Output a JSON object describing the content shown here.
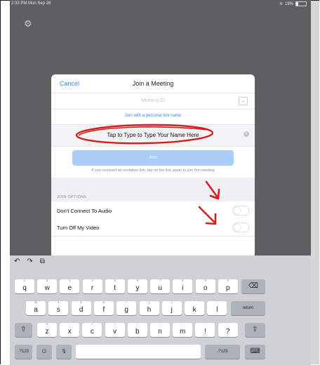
{
  "status_bar": {
    "time": "2:33 PM  Mon Sep 28",
    "battery": "19%"
  },
  "dialog": {
    "cancel": "Cancel",
    "title": "Join a Meeting",
    "meeting_id_placeholder": "Meeting ID",
    "personal_link": "Join with a personal link name",
    "name_field": "Tap to Type to Type Your Name Here",
    "join_button": "Join",
    "invite_text": "If you received an invitation link, tap on the link again to join the meeting",
    "join_options_label": "JOIN OPTIONS",
    "option_audio": "Don't Connect To Audio",
    "option_video": "Turn Off My Video"
  },
  "keyboard": {
    "row1": [
      {
        "main": "q",
        "sub": "1"
      },
      {
        "main": "w",
        "sub": "2"
      },
      {
        "main": "e",
        "sub": "3"
      },
      {
        "main": "r",
        "sub": "4"
      },
      {
        "main": "t",
        "sub": "5"
      },
      {
        "main": "y",
        "sub": "6"
      },
      {
        "main": "u",
        "sub": "7"
      },
      {
        "main": "i",
        "sub": "8"
      },
      {
        "main": "o",
        "sub": "9"
      },
      {
        "main": "p",
        "sub": "0"
      }
    ],
    "row2": [
      {
        "main": "a",
        "sub": "@"
      },
      {
        "main": "s",
        "sub": "#"
      },
      {
        "main": "d",
        "sub": "$"
      },
      {
        "main": "f",
        "sub": "&"
      },
      {
        "main": "g",
        "sub": "*"
      },
      {
        "main": "h",
        "sub": "("
      },
      {
        "main": "j",
        "sub": ")"
      },
      {
        "main": "k",
        "sub": "'"
      },
      {
        "main": "l",
        "sub": "\""
      }
    ],
    "row3": [
      {
        "main": "z",
        "sub": "%"
      },
      {
        "main": "x",
        "sub": "-"
      },
      {
        "main": "c",
        "sub": "+"
      },
      {
        "main": "v",
        "sub": "="
      },
      {
        "main": "b",
        "sub": "/"
      },
      {
        "main": "n",
        "sub": ";"
      },
      {
        "main": "m",
        "sub": ":"
      },
      {
        "main": "!",
        "sub": ","
      },
      {
        "main": "?",
        "sub": "."
      }
    ],
    "return_key": "return",
    "numbers_key": ".?123",
    "numbers_key_right": ".?123"
  }
}
